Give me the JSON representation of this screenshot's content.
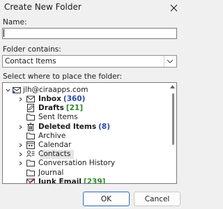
{
  "dialog": {
    "title": "Create New Folder",
    "close_glyph": "✕"
  },
  "name_field": {
    "label": "Name:",
    "value": ""
  },
  "folder_contains": {
    "label": "Folder contains:",
    "value": "Contact Items"
  },
  "tree_section": {
    "label": "Select where to place the folder:"
  },
  "tree": {
    "account": {
      "label": "jlh@ciraapps.com",
      "icon": "mailbox-icon"
    },
    "items": [
      {
        "label": "Inbox",
        "count": "(360)",
        "bold": true,
        "icon": "inbox-icon",
        "expandable": true
      },
      {
        "label": "Drafts",
        "count": "[21]",
        "count_style": "green",
        "bold": true,
        "icon": "drafts-icon",
        "expandable": false
      },
      {
        "label": "Sent Items",
        "count": "",
        "bold": false,
        "icon": "folder-icon",
        "expandable": false
      },
      {
        "label": "Deleted Items",
        "count": "(8)",
        "bold": true,
        "icon": "trash-icon",
        "expandable": true
      },
      {
        "label": "Archive",
        "count": "",
        "bold": false,
        "icon": "folder-icon",
        "expandable": false
      },
      {
        "label": "Calendar",
        "count": "",
        "bold": false,
        "icon": "calendar-icon",
        "expandable": true
      },
      {
        "label": "Contacts",
        "count": "",
        "bold": false,
        "icon": "contacts-icon",
        "expandable": true,
        "selected": true
      },
      {
        "label": "Conversation History",
        "count": "",
        "bold": false,
        "icon": "folder-icon",
        "expandable": true
      },
      {
        "label": "Journal",
        "count": "",
        "bold": false,
        "icon": "folder-icon",
        "expandable": false
      },
      {
        "label": "Junk Email",
        "count": "[239]",
        "count_style": "green",
        "bold": true,
        "icon": "junk-icon",
        "expandable": false
      }
    ]
  },
  "buttons": {
    "ok": "OK",
    "cancel": "Cancel"
  },
  "colors": {
    "accent": "#2d6cc1",
    "count_blue": "#2a4aa5",
    "count_green": "#2d8a2d",
    "selection": "#e5e5e5"
  }
}
